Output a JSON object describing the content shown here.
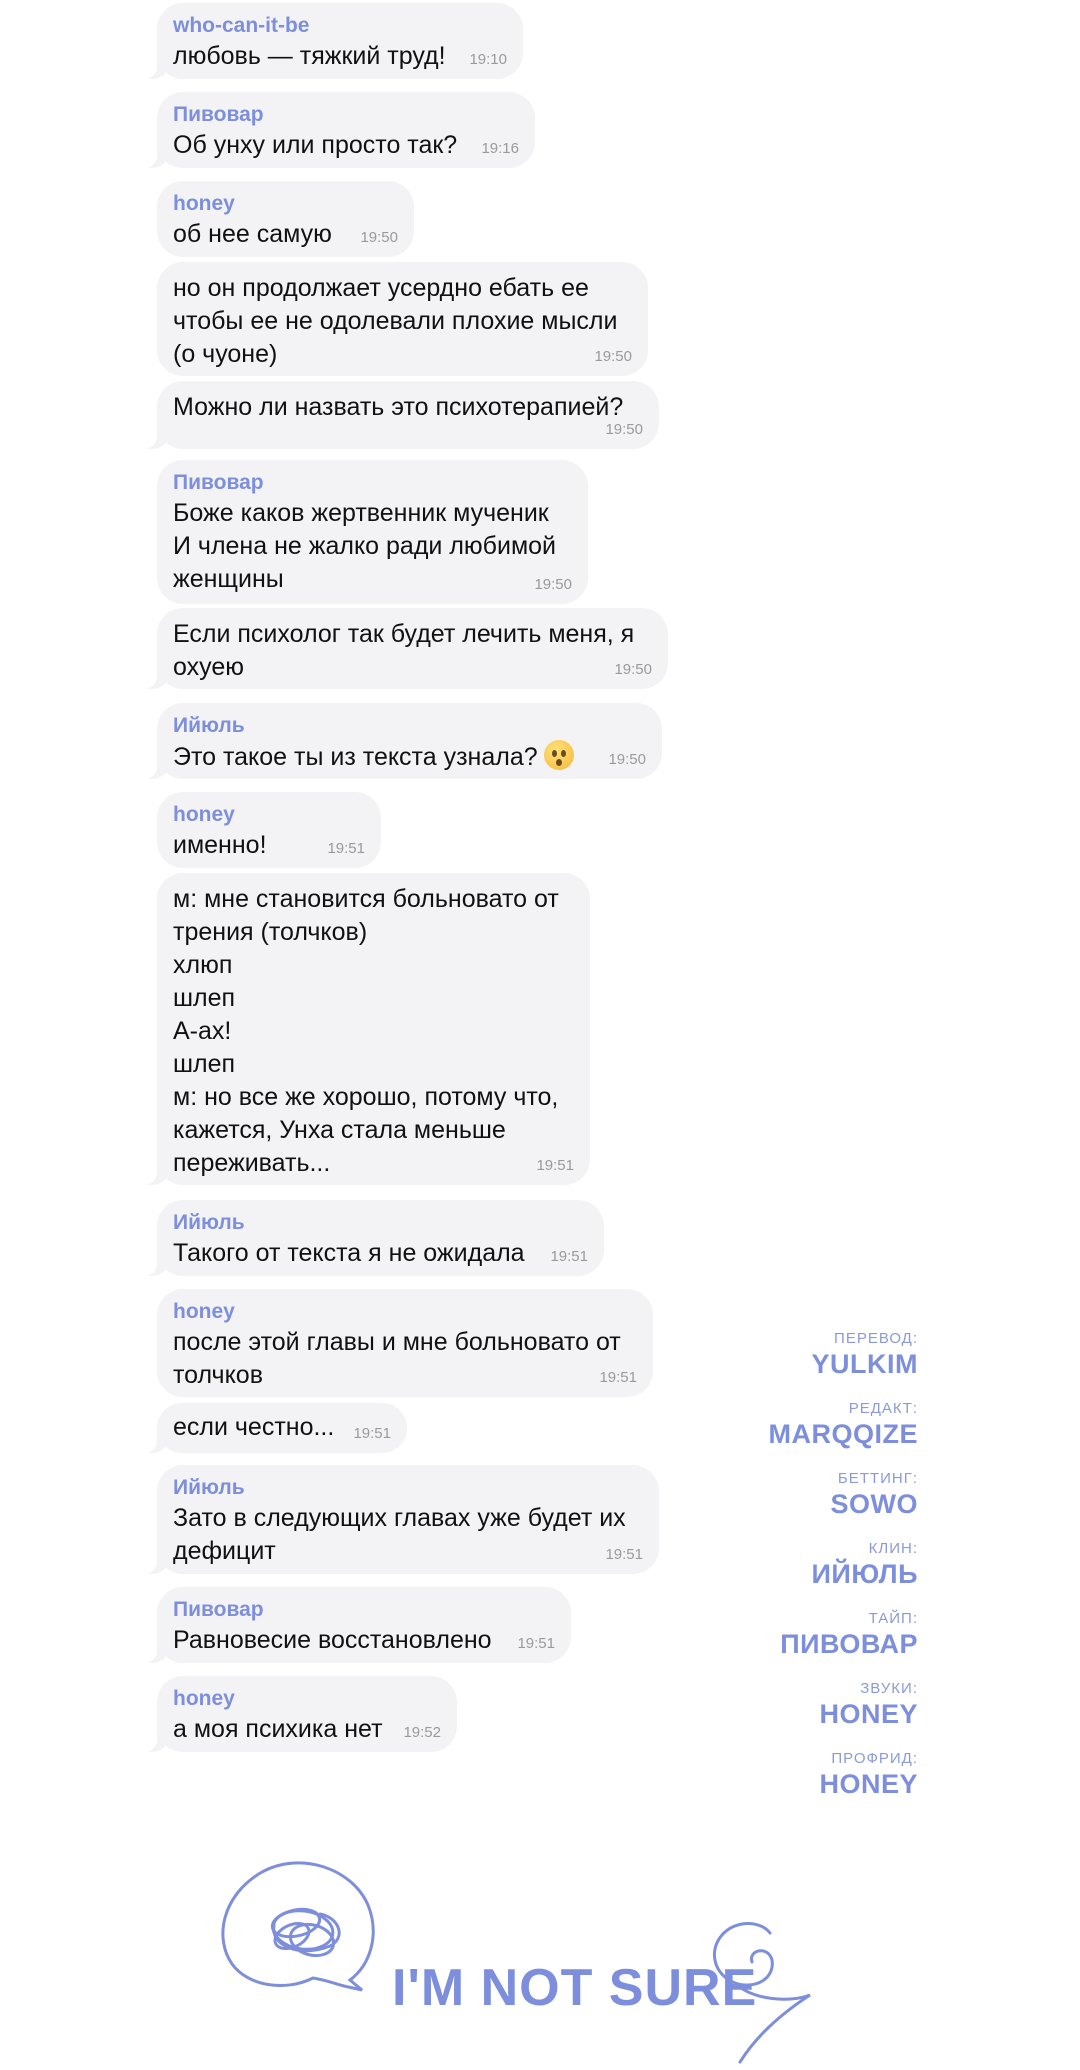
{
  "messages": [
    {
      "sender": "who-can-it-be",
      "text": "любовь — тяжкий труд!",
      "time": "19:10"
    },
    {
      "sender": "Пивовар",
      "text": "Об унху или просто так?",
      "time": "19:16"
    },
    {
      "sender": "honey",
      "text": "об нее самую",
      "time": "19:50"
    },
    {
      "sender": "",
      "text": "но он продолжает усердно ебать ее\nчтобы ее не одолевали плохие мысли\n(о чуоне)",
      "time": "19:50"
    },
    {
      "sender": "",
      "text": "Можно ли назвать это психотерапией?",
      "time": "19:50"
    },
    {
      "sender": "Пивовар",
      "text": "Боже каков жертвенник мученик\nИ члена не жалко ради любимой\nженщины",
      "time": "19:50"
    },
    {
      "sender": "",
      "text": "Если психолог так будет лечить меня, я\nохуею",
      "time": "19:50"
    },
    {
      "sender": "Ийюль",
      "text": "Это такое ты из текста узнала?",
      "time": "19:50"
    },
    {
      "sender": "honey",
      "text": "именно!",
      "time": "19:51"
    },
    {
      "sender": "",
      "text": "м: мне становится больновато от\nтрения (толчков)\nхлюп\nшлеп\nА-ах!\nшлеп\nм: но все же хорошо, потому что,\nкажется, Унха стала меньше\nпереживать...",
      "time": "19:51"
    },
    {
      "sender": "Ийюль",
      "text": "Такого от текста я не ожидала",
      "time": "19:51"
    },
    {
      "sender": "honey",
      "text": "после этой главы и мне больновато от\nтолчков",
      "time": "19:51"
    },
    {
      "sender": "",
      "text": "если честно...",
      "time": "19:51"
    },
    {
      "sender": "Ийюль",
      "text": "Зато в следующих главах уже будет их\nдефицит",
      "time": "19:51"
    },
    {
      "sender": "Пивовар",
      "text": "Равновесие восстановлено",
      "time": "19:51"
    },
    {
      "sender": "honey",
      "text": "а моя психика нет",
      "time": "19:52"
    }
  ],
  "credits": [
    {
      "role": "ПЕРЕВОД:",
      "name": "YULKIM"
    },
    {
      "role": "РЕДАКТ:",
      "name": "MARQQIZE"
    },
    {
      "role": "БЕТТИНГ:",
      "name": "SOWO"
    },
    {
      "role": "КЛИН:",
      "name": "ИЙЮЛЬ"
    },
    {
      "role": "ТАЙП:",
      "name": "ПИВОВАР"
    },
    {
      "role": "ЗВУКИ:",
      "name": "HONEY"
    },
    {
      "role": "ПРОФРИД:",
      "name": "HONEY"
    }
  ],
  "logo": {
    "text": "I'M NOT SURE"
  },
  "icons": {
    "emoji": "astonished-face-icon",
    "logo_mark": "scribble-speech-bubble-icon",
    "logo_swirl": "swirl-icon"
  },
  "colors": {
    "accent": "#7d8fdc",
    "bubble": "#f3f3f5",
    "time": "#9a9a9a"
  }
}
